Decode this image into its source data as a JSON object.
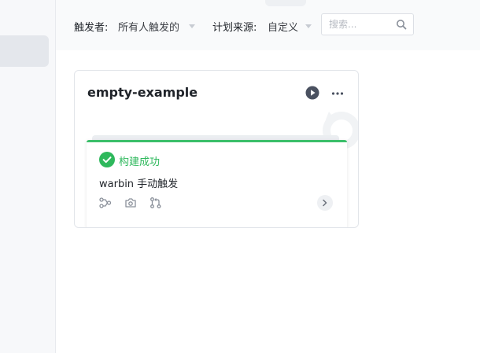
{
  "filters": {
    "trigger_label": "触发者:",
    "trigger_value": "所有人触发的",
    "source_label": "计划来源:",
    "source_value": "自定义",
    "search_placeholder": "搜索..."
  },
  "card": {
    "title": "empty-example",
    "build": {
      "status": "构建成功",
      "trigger": "warbin 手动触发"
    }
  },
  "colors": {
    "success": "#2eb85c",
    "icon": "#4a5160"
  },
  "icons": [
    "search-icon",
    "play-icon",
    "more-icon",
    "check-circle-icon",
    "pipeline-icon",
    "camera-icon",
    "merge-request-icon",
    "chevron-right-icon"
  ]
}
